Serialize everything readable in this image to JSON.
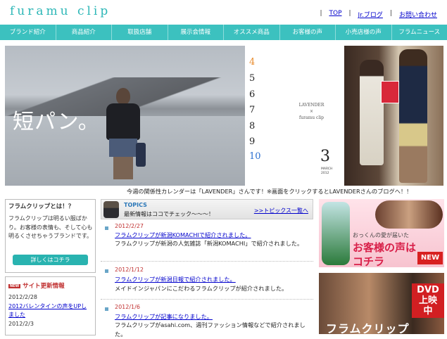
{
  "header": {
    "logo": "furamu clip",
    "links": [
      "TOP",
      "Jr.ブログ",
      "お問い合わせ"
    ]
  },
  "nav": [
    "ブランド紹介",
    "商品紹介",
    "取扱店舗",
    "展示会情報",
    "オススメ商品",
    "お客様の声",
    "小売店様の声",
    "フラムニュース"
  ],
  "hero": {
    "text": "短パン。",
    "calendar": [
      "4",
      "5",
      "6",
      "7",
      "8",
      "9",
      "10"
    ],
    "lavender": "LAVENDER",
    "x": "×",
    "brand": "furamu clip",
    "month_num": "3",
    "month": "MARCH",
    "year": "2012",
    "caption": "今週の関係性カレンダーは「LAVENDER」さんです！※画面をクリックするとLAVENDERさんのブログへ！！"
  },
  "about": {
    "title": "フラムクリップとは！？",
    "body": "フラムクリップは明るい服ばかり。お客様の表情も、そして心も明るくさせちゃうブランドです。",
    "button": "詳しくはコチラ"
  },
  "updates": {
    "icon": "NEW",
    "title": "サイト更新情報",
    "items": [
      {
        "date": "2012/2/28",
        "text": "2012バレンタインの声をUPしました"
      },
      {
        "date": "2012/2/3",
        "text": ""
      }
    ]
  },
  "topics": {
    "label": "TOPICS",
    "sub": "最新情報はココでチェック～～～！",
    "more": ">>トピックス一覧へ",
    "items": [
      {
        "date": "2012/2/27",
        "title": "フラムクリップが新潟KOMACHIで紹介されました。",
        "body": "フラムクリップが新潟の人気雑誌「新潟KOMACHI」で紹介されました。"
      },
      {
        "date": "2012/1/12",
        "title": "フラムクリップが新潟日報で紹介されました。",
        "body": "メイドインジャパンにこだわるフラムクリップが紹介されました。"
      },
      {
        "date": "2012/1/6",
        "title": "フラムクリップが記事になりました。",
        "body": "フラムクリップがasahi.com、週刊ファッション情報などで紹介されました。"
      }
    ]
  },
  "banner1": {
    "small": "おっくんの愛が届いた",
    "big": "お客様の声は",
    "bottom": "コチラ",
    "new": "NEW"
  },
  "banner2": {
    "dvd": "DVD上映中",
    "title": "フラムクリップ"
  }
}
